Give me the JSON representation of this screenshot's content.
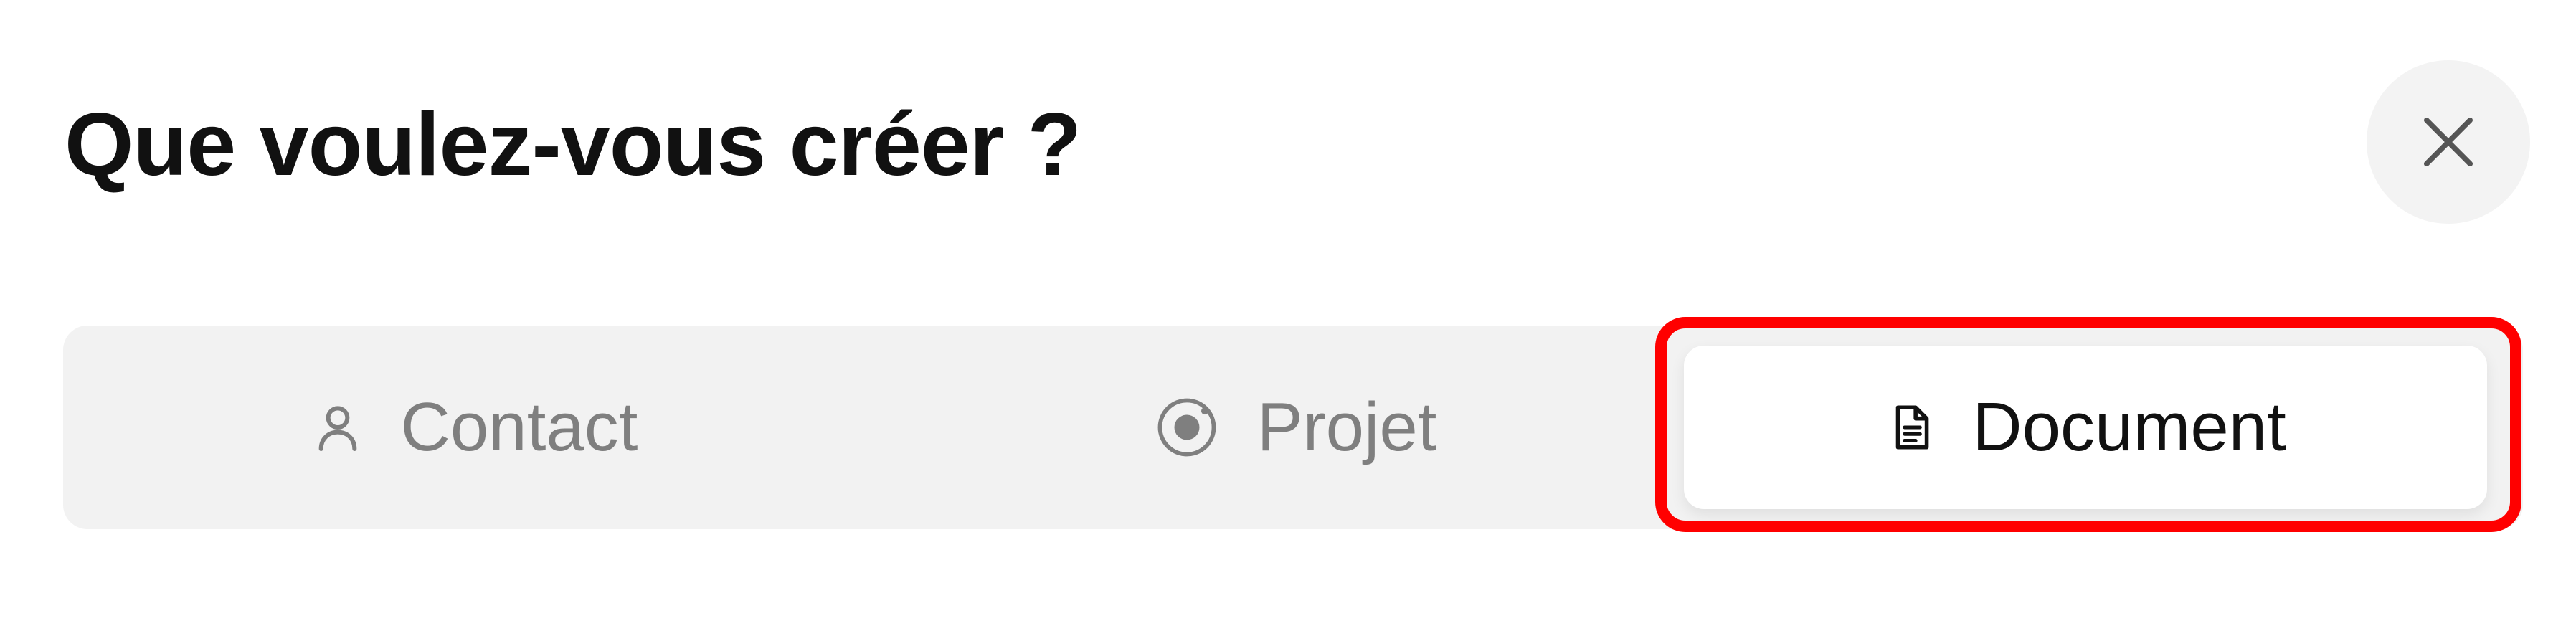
{
  "dialog": {
    "title": "Que voulez-vous créer ?",
    "close_icon": "close-icon"
  },
  "tabs": [
    {
      "label": "Contact",
      "icon": "user-icon",
      "selected": false
    },
    {
      "label": "Projet",
      "icon": "target-icon",
      "selected": false
    },
    {
      "label": "Document",
      "icon": "document-icon",
      "selected": true
    }
  ],
  "colors": {
    "title": "#111111",
    "inactive_text": "#7f7f7f",
    "active_text": "#111111",
    "segmented_background": "#f2f2f2",
    "active_tab_background": "#ffffff",
    "close_button_background": "#f3f3f3",
    "highlight": "#ff0000"
  }
}
